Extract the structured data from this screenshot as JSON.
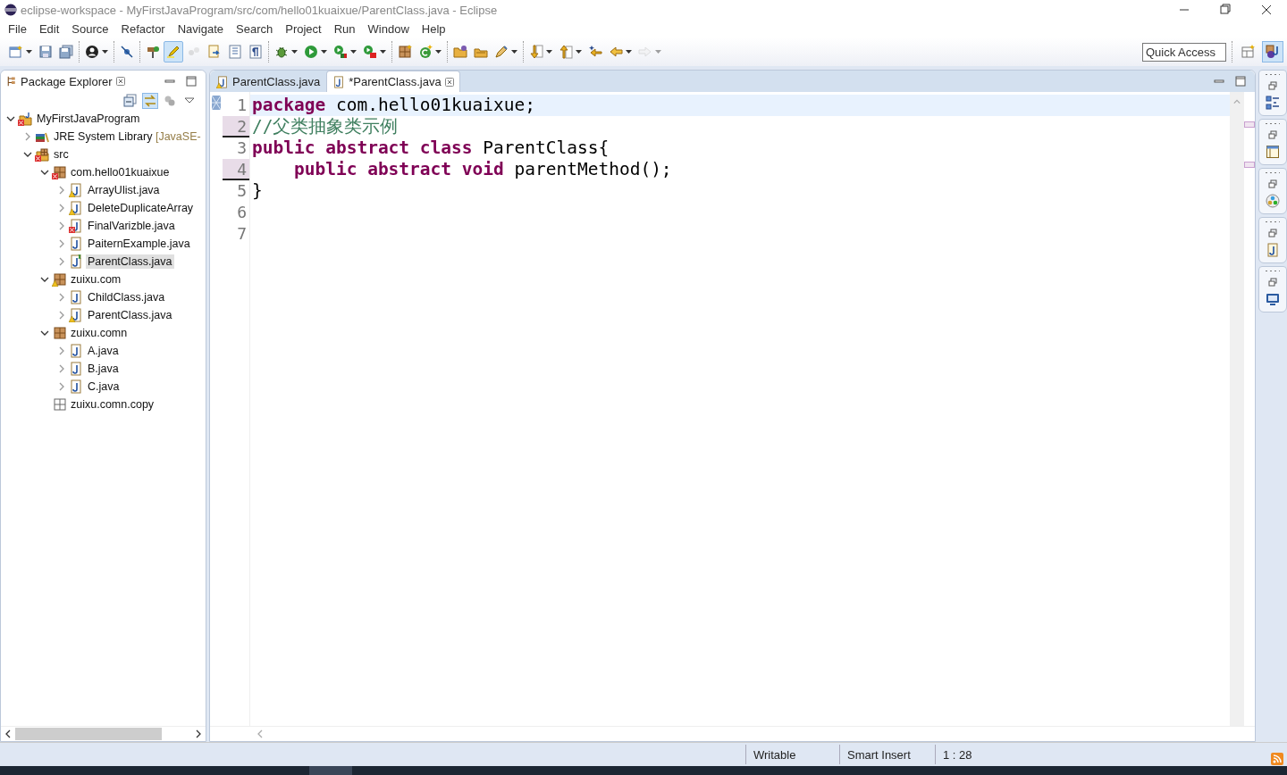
{
  "window": {
    "title": "eclipse-workspace - MyFirstJavaProgram/src/com/hello01kuaixue/ParentClass.java - Eclipse"
  },
  "menu": [
    "File",
    "Edit",
    "Source",
    "Refactor",
    "Navigate",
    "Search",
    "Project",
    "Run",
    "Window",
    "Help"
  ],
  "toolbar": {
    "groups": [
      [
        {
          "kind": "new",
          "dropdown": true,
          "pressed": false,
          "disabled": false
        },
        {
          "kind": "save",
          "dropdown": false,
          "pressed": false,
          "disabled": false
        },
        {
          "kind": "save-all",
          "dropdown": false,
          "pressed": false,
          "disabled": false
        }
      ],
      [
        {
          "kind": "user",
          "dropdown": true,
          "pressed": false,
          "disabled": false
        }
      ],
      [
        {
          "kind": "breakpoint-slash",
          "dropdown": false,
          "pressed": false,
          "disabled": false
        }
      ],
      [
        {
          "kind": "signpost",
          "dropdown": false,
          "pressed": false,
          "disabled": false
        },
        {
          "kind": "highlighter",
          "dropdown": false,
          "pressed": true,
          "disabled": false
        },
        {
          "kind": "dots",
          "dropdown": false,
          "pressed": false,
          "disabled": true
        },
        {
          "kind": "doc-arrow",
          "dropdown": false,
          "pressed": false,
          "disabled": false
        },
        {
          "kind": "block",
          "dropdown": false,
          "pressed": false,
          "disabled": false
        },
        {
          "kind": "pilcrow",
          "dropdown": false,
          "pressed": false,
          "disabled": false
        }
      ],
      [
        {
          "kind": "bug",
          "dropdown": true,
          "pressed": false,
          "disabled": false
        },
        {
          "kind": "play",
          "dropdown": true,
          "pressed": false,
          "disabled": false
        },
        {
          "kind": "run-coverage",
          "dropdown": true,
          "pressed": false,
          "disabled": false
        },
        {
          "kind": "run-tools",
          "dropdown": true,
          "pressed": false,
          "disabled": false
        }
      ],
      [
        {
          "kind": "package",
          "dropdown": false,
          "pressed": false,
          "disabled": false
        },
        {
          "kind": "class",
          "dropdown": true,
          "pressed": false,
          "disabled": false
        }
      ],
      [
        {
          "kind": "folder",
          "dropdown": false,
          "pressed": false,
          "disabled": false
        },
        {
          "kind": "tray",
          "dropdown": false,
          "pressed": false,
          "disabled": false
        },
        {
          "kind": "pencil",
          "dropdown": true,
          "pressed": false,
          "disabled": false
        }
      ],
      [
        {
          "kind": "arrow-down",
          "dropdown": true,
          "pressed": false,
          "disabled": false
        },
        {
          "kind": "arrow-up",
          "dropdown": true,
          "pressed": false,
          "disabled": false
        },
        {
          "kind": "arrow-star",
          "dropdown": false,
          "pressed": false,
          "disabled": false
        },
        {
          "kind": "back",
          "dropdown": true,
          "pressed": false,
          "disabled": false
        },
        {
          "kind": "forward",
          "dropdown": true,
          "pressed": false,
          "disabled": true
        }
      ]
    ]
  },
  "quick_access": {
    "placeholder": "Quick Access"
  },
  "package_explorer": {
    "title": "Package Explorer",
    "tree": [
      {
        "label": "MyFirstJavaProgram",
        "kind": "project",
        "error": true,
        "warning": false,
        "expanded": true,
        "selected": false,
        "children": [
          {
            "label": "JRE System Library",
            "qualifier": "[JavaSE-",
            "kind": "library",
            "error": false,
            "warning": false,
            "expanded": false,
            "selected": false
          },
          {
            "label": "src",
            "kind": "source-folder",
            "error": true,
            "warning": false,
            "expanded": true,
            "selected": false,
            "children": [
              {
                "label": "com.hello01kuaixue",
                "kind": "package",
                "error": true,
                "warning": false,
                "expanded": true,
                "selected": false,
                "children": [
                  {
                    "label": "ArrayUlist.java",
                    "kind": "file",
                    "error": false,
                    "warning": true,
                    "expanded": false,
                    "selected": false
                  },
                  {
                    "label": "DeleteDuplicateArray",
                    "kind": "file",
                    "error": false,
                    "warning": true,
                    "expanded": false,
                    "selected": false
                  },
                  {
                    "label": "FinalVarizble.java",
                    "kind": "file",
                    "error": true,
                    "warning": false,
                    "expanded": false,
                    "selected": false
                  },
                  {
                    "label": "PaiternExample.java",
                    "kind": "file",
                    "error": false,
                    "warning": false,
                    "expanded": false,
                    "selected": false
                  },
                  {
                    "label": "ParentClass.java",
                    "kind": "abstract-file",
                    "error": false,
                    "warning": false,
                    "expanded": false,
                    "selected": true
                  }
                ]
              },
              {
                "label": "zuixu.com",
                "kind": "package",
                "error": false,
                "warning": true,
                "expanded": true,
                "selected": false,
                "children": [
                  {
                    "label": "ChildClass.java",
                    "kind": "file",
                    "error": false,
                    "warning": false,
                    "expanded": false,
                    "selected": false
                  },
                  {
                    "label": "ParentClass.java",
                    "kind": "file",
                    "error": false,
                    "warning": true,
                    "expanded": false,
                    "selected": false
                  }
                ]
              },
              {
                "label": "zuixu.comn",
                "kind": "package",
                "error": false,
                "warning": false,
                "expanded": true,
                "selected": false,
                "children": [
                  {
                    "label": "A.java",
                    "kind": "file",
                    "error": false,
                    "warning": false,
                    "expanded": false,
                    "selected": false
                  },
                  {
                    "label": "B.java",
                    "kind": "file",
                    "error": false,
                    "warning": false,
                    "expanded": false,
                    "selected": false
                  },
                  {
                    "label": "C.java",
                    "kind": "file",
                    "error": false,
                    "warning": false,
                    "expanded": false,
                    "selected": false
                  }
                ]
              },
              {
                "label": "zuixu.comn.copy",
                "kind": "empty-package",
                "error": false,
                "warning": false,
                "selected": false
              }
            ]
          }
        ]
      }
    ]
  },
  "editor": {
    "tabs": [
      {
        "label": "ParentClass.java",
        "error": false,
        "warning": true,
        "selected": false
      },
      {
        "label": "*ParentClass.java",
        "error": false,
        "warning": false,
        "selected": true
      }
    ],
    "lines": [
      {
        "number": "1",
        "current": true,
        "changed": false,
        "tokens": [
          {
            "kind": "keyword",
            "text": "package"
          },
          {
            "kind": "plain",
            "text": " com.hello01kuaixue;"
          }
        ]
      },
      {
        "number": "2",
        "current": false,
        "changed": true,
        "tokens": [
          {
            "kind": "comment",
            "text": "//父类抽象类示例"
          }
        ]
      },
      {
        "number": "3",
        "current": false,
        "changed": false,
        "tokens": [
          {
            "kind": "keyword",
            "text": "public abstract class"
          },
          {
            "kind": "plain",
            "text": " ParentClass{"
          }
        ]
      },
      {
        "number": "4",
        "current": false,
        "changed": true,
        "tokens": [
          {
            "kind": "keyword",
            "text": "    public abstract void"
          },
          {
            "kind": "plain",
            "text": " parentMethod();"
          }
        ]
      },
      {
        "number": "5",
        "current": false,
        "changed": false,
        "tokens": [
          {
            "kind": "plain",
            "text": "}"
          }
        ]
      },
      {
        "number": "6",
        "current": false,
        "changed": false
      },
      {
        "number": "7",
        "current": false,
        "changed": false
      }
    ]
  },
  "trim_stacks": [
    {
      "kind": "outline"
    },
    {
      "kind": "panel"
    },
    {
      "kind": "palette"
    },
    {
      "kind": "javadoc"
    },
    {
      "kind": "console"
    }
  ],
  "status_bar": {
    "fields": [
      "Writable",
      "Smart Insert",
      "1 : 28"
    ]
  }
}
